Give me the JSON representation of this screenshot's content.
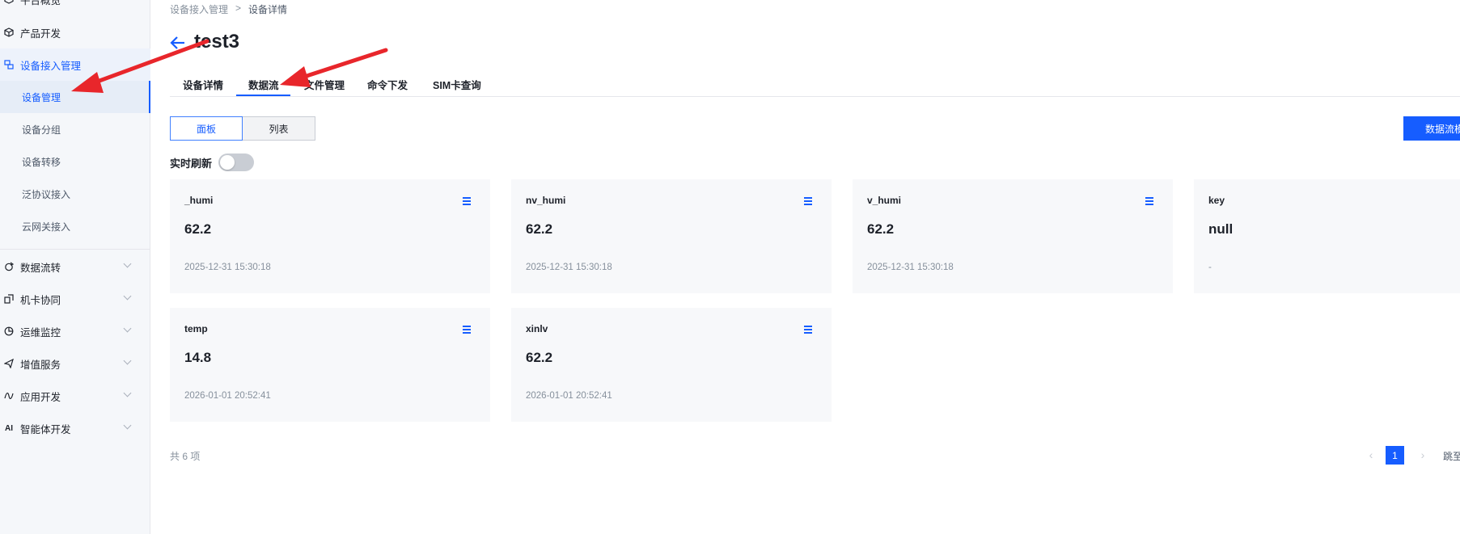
{
  "sidebar": {
    "items": [
      {
        "label": "平台概览",
        "icon": "dashboard-icon"
      },
      {
        "label": "产品开发",
        "icon": "cube-icon"
      },
      {
        "label": "设备接入管理",
        "icon": "device-access-icon"
      },
      {
        "label": "数据流转",
        "icon": "data-flow-icon"
      },
      {
        "label": "机卡协同",
        "icon": "sim-card-icon"
      },
      {
        "label": "运维监控",
        "icon": "monitor-icon"
      },
      {
        "label": "增值服务",
        "icon": "paper-plane-icon"
      },
      {
        "label": "应用开发",
        "icon": "app-dev-icon"
      },
      {
        "label": "智能体开发",
        "icon": "ai-icon"
      }
    ],
    "ai_glyph": "AI",
    "sub_items": [
      {
        "label": "设备管理"
      },
      {
        "label": "设备分组"
      },
      {
        "label": "设备转移"
      },
      {
        "label": "泛协议接入"
      },
      {
        "label": "云网关接入"
      }
    ]
  },
  "breadcrumb": {
    "items": [
      "设备接入管理",
      "设备详情"
    ],
    "separator": ">"
  },
  "header": {
    "title": "test3"
  },
  "tabs": [
    {
      "label": "设备详情"
    },
    {
      "label": "数据流"
    },
    {
      "label": "文件管理"
    },
    {
      "label": "命令下发"
    },
    {
      "label": "SIM卡查询"
    }
  ],
  "active_tab": "数据流",
  "view_toggle": {
    "options": [
      "面板",
      "列表"
    ],
    "selected": "面板"
  },
  "primary_button": {
    "label": "数据流模"
  },
  "realtime_refresh": {
    "label": "实时刷新",
    "enabled": false
  },
  "cards": [
    {
      "name": "_humi",
      "value": "62.2",
      "time": "2025-12-31 15:30:18"
    },
    {
      "name": "nv_humi",
      "value": "62.2",
      "time": "2025-12-31 15:30:18"
    },
    {
      "name": "v_humi",
      "value": "62.2",
      "time": "2025-12-31 15:30:18"
    },
    {
      "name": "key",
      "value": "null",
      "time": "-"
    },
    {
      "name": "temp",
      "value": "14.8",
      "time": "2026-01-01 20:52:41"
    },
    {
      "name": "xinlv",
      "value": "62.2",
      "time": "2026-01-01 20:52:41"
    }
  ],
  "footer": {
    "total": "共 6 项"
  },
  "pagination": {
    "current_page": "1",
    "jump_label": "跳至"
  },
  "colors": {
    "accent": "#165dff",
    "annotation_arrow": "#e8262b"
  }
}
